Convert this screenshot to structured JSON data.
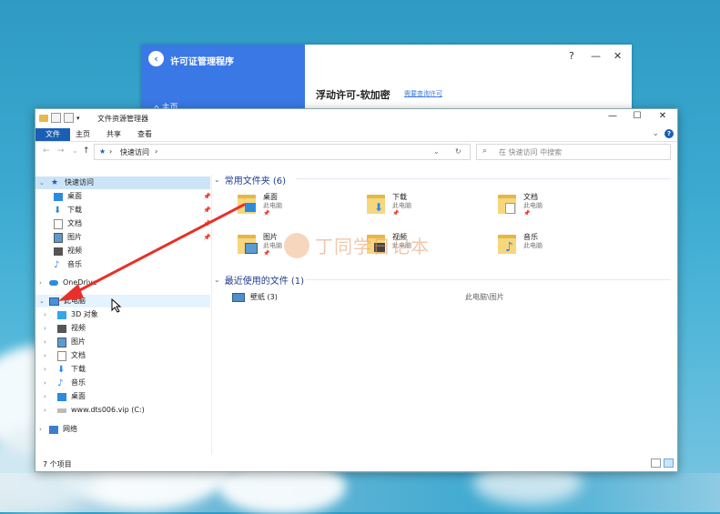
{
  "license_window": {
    "title": "许可证管理程序",
    "home_label": "主页",
    "heading": "浮动许可-软加密",
    "link": "需要查询许可",
    "help": "?",
    "minimize": "—",
    "close": "✕"
  },
  "explorer": {
    "title": "文件资源管理器",
    "controls": {
      "minimize": "—",
      "maximize": "☐",
      "close": "✕"
    },
    "ribbon_tabs": [
      "文件",
      "主页",
      "共享",
      "查看"
    ],
    "ribbon_chevron": "⌄",
    "ribbon_help": "?",
    "nav": {
      "back": "←",
      "forward": "→",
      "recent": "⌄",
      "up": "↑"
    },
    "address": "快速访问",
    "address_sep": "›",
    "address_dropdown": "⌄",
    "address_refresh": "↻",
    "search_placeholder": "在 快速访问 中搜索",
    "sidebar": {
      "quick_access": "快速访问",
      "quick_items": [
        "桌面",
        "下载",
        "文档",
        "图片",
        "视频",
        "音乐"
      ],
      "onedrive": "OneDrive",
      "this_pc": "此电脑",
      "pc_items": [
        "3D 对象",
        "视频",
        "图片",
        "文档",
        "下载",
        "音乐",
        "桌面",
        "www.dts006.vip (C:)"
      ],
      "network": "网络"
    },
    "frequent_header": "常用文件夹 (6)",
    "frequent": [
      {
        "name": "桌面",
        "location": "此电脑"
      },
      {
        "name": "下载",
        "location": "此电脑"
      },
      {
        "name": "文档",
        "location": "此电脑"
      },
      {
        "name": "图片",
        "location": "此电脑"
      },
      {
        "name": "视频",
        "location": "此电脑"
      },
      {
        "name": "音乐",
        "location": "此电脑"
      }
    ],
    "recent_header": "最近使用的文件 (1)",
    "recent": [
      {
        "name": "壁纸 (3)",
        "path": "此电脑\\图片"
      }
    ],
    "status": "7 个项目"
  },
  "watermark": "丁同学日记本",
  "colors": {
    "accent": "#1a5fb4",
    "license_blue": "#3a78e6",
    "arrow": "#e8302a"
  }
}
